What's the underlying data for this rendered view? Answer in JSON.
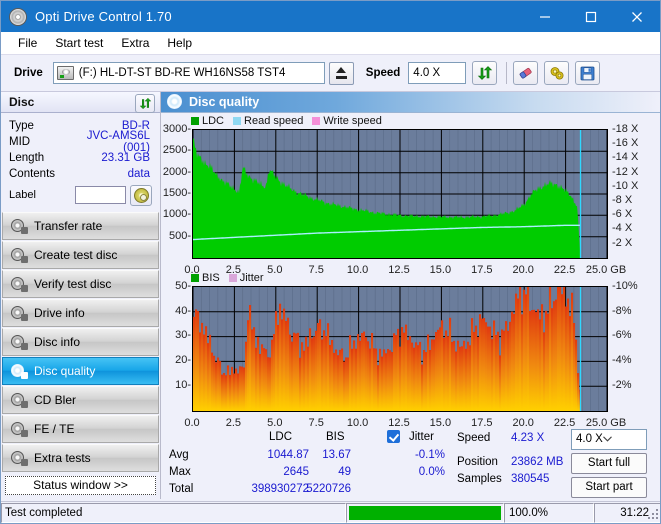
{
  "window": {
    "title": "Opti Drive Control 1.70",
    "icon": "disc-icon",
    "minimize": "minimize-icon",
    "maximize": "maximize-icon",
    "close": "close-icon"
  },
  "menu": [
    {
      "label": "File"
    },
    {
      "label": "Start test"
    },
    {
      "label": "Extra"
    },
    {
      "label": "Help"
    }
  ],
  "toolbar": {
    "drive_label": "Drive",
    "drive_value": "(F:)  HL-DT-ST BD-RE  WH16NS58 TST4",
    "eject_icon": "eject-icon",
    "speed_label": "Speed",
    "speed_value": "4.0 X",
    "refresh_icon": "refresh-icon",
    "erase_icon": "eraser-icon",
    "settings_icon": "gears-icon",
    "save_icon": "save-icon"
  },
  "disc_panel": {
    "title": "Disc",
    "refresh_icon": "refresh-icon",
    "rows": [
      {
        "key": "Type",
        "value": "BD-R"
      },
      {
        "key": "MID",
        "value": "JVC-AMS6L (001)"
      },
      {
        "key": "Length",
        "value": "23.31 GB"
      },
      {
        "key": "Contents",
        "value": "data"
      }
    ],
    "label_key": "Label",
    "label_value": "",
    "label_button_icon": "cd-icon"
  },
  "nav": {
    "items": [
      {
        "label": "Transfer rate",
        "active": false
      },
      {
        "label": "Create test disc",
        "active": false
      },
      {
        "label": "Verify test disc",
        "active": false
      },
      {
        "label": "Drive info",
        "active": false
      },
      {
        "label": "Disc info",
        "active": false
      },
      {
        "label": "Disc quality",
        "active": true
      },
      {
        "label": "CD Bler",
        "active": false
      },
      {
        "label": "FE / TE",
        "active": false
      },
      {
        "label": "Extra tests",
        "active": false
      }
    ],
    "status_window": "Status window >>"
  },
  "main": {
    "title": "Disc quality",
    "icon": "disc-quality-icon"
  },
  "stats": {
    "col_ldc": "LDC",
    "col_bis": "BIS",
    "jitter_label": "Jitter",
    "jitter_checked": true,
    "rows": [
      {
        "key": "Avg",
        "ldc": "1044.87",
        "bis": "13.67",
        "jitter": "-0.1%"
      },
      {
        "key": "Max",
        "ldc": "2645",
        "bis": "49",
        "jitter": "0.0%"
      },
      {
        "key": "Total",
        "ldc": "398930272",
        "bis": "5220726",
        "jitter": ""
      }
    ],
    "speed_key": "Speed",
    "speed_value": "4.23 X",
    "speed_select": "4.0 X",
    "position_key": "Position",
    "position_value": "23862 MB",
    "samples_key": "Samples",
    "samples_value": "380545",
    "start_full": "Start full",
    "start_part": "Start part"
  },
  "statusbar": {
    "text": "Test completed",
    "percent": "100.0%",
    "progress": 100,
    "time": "31:22"
  },
  "chart_data": [
    {
      "type": "area",
      "name": "ldc-chart",
      "title": "",
      "xlabel": "GB",
      "ylabel": "",
      "xlim": [
        0.0,
        25.0
      ],
      "xticks": [
        "0.0",
        "2.5",
        "5.0",
        "7.5",
        "10.0",
        "12.5",
        "15.0",
        "17.5",
        "20.0",
        "22.5",
        "25.0 GB"
      ],
      "xtickvals": [
        0.0,
        2.5,
        5.0,
        7.5,
        10.0,
        12.5,
        15.0,
        17.5,
        20.0,
        22.5,
        25.0
      ],
      "ylim": [
        0,
        3000
      ],
      "yticks": [
        "500",
        "1000",
        "1500",
        "2000",
        "2500",
        "3000"
      ],
      "ytickvals": [
        500,
        1000,
        1500,
        2000,
        2500,
        3000
      ],
      "y2lim": [
        0,
        18
      ],
      "y2ticks": [
        "2 X",
        "4 X",
        "6 X",
        "8 X",
        "10 X",
        "12 X",
        "14 X",
        "16 X",
        "18 X"
      ],
      "y2tickvals": [
        2,
        4,
        6,
        8,
        10,
        12,
        14,
        16,
        18
      ],
      "grid": true,
      "legend": [
        {
          "label": "LDC",
          "color": "#00a000"
        },
        {
          "label": "Read speed",
          "color": "#8fd8f2"
        },
        {
          "label": "Write speed",
          "color": "#f58fd8"
        }
      ],
      "series": [
        {
          "name": "LDC",
          "color": "#00cc00",
          "x": [
            0.0,
            0.2,
            0.4,
            0.6,
            0.8,
            1.0,
            1.2,
            1.4,
            1.6,
            1.8,
            2.0,
            2.2,
            2.4,
            2.6,
            2.8,
            3.0,
            3.2,
            3.4,
            3.6,
            3.8,
            4.0,
            4.2,
            4.4,
            4.6,
            4.8,
            5.0,
            5.2,
            5.4,
            5.6,
            5.8,
            6.0,
            6.4,
            6.8,
            7.2,
            7.6,
            8.0,
            8.4,
            8.8,
            9.2,
            9.6,
            10.0,
            10.5,
            11.0,
            11.5,
            12.0,
            12.5,
            13.0,
            13.5,
            14.0,
            14.5,
            15.0,
            15.5,
            16.0,
            16.5,
            17.0,
            17.5,
            18.0,
            18.5,
            19.0,
            19.5,
            20.0,
            20.4,
            20.8,
            21.2,
            21.6,
            22.0,
            22.4,
            22.8,
            23.2,
            23.4
          ],
          "values": [
            2800,
            2450,
            2350,
            2300,
            2200,
            2150,
            2050,
            1950,
            1900,
            1800,
            1750,
            1700,
            1650,
            1600,
            1530,
            2120,
            2000,
            1920,
            1850,
            1800,
            1740,
            1700,
            1680,
            2080,
            1980,
            1900,
            1820,
            1760,
            1700,
            1650,
            1600,
            1520,
            1460,
            1400,
            1350,
            1300,
            1260,
            1230,
            1200,
            1160,
            1130,
            1100,
            1060,
            1040,
            1020,
            1000,
            990,
            980,
            975,
            970,
            965,
            960,
            955,
            960,
            965,
            975,
            990,
            1020,
            1060,
            1120,
            1260,
            1480,
            1620,
            1700,
            1750,
            1720,
            1600,
            1480,
            1200,
            0
          ]
        },
        {
          "name": "Read speed",
          "color": "#a9f0ff",
          "x": [
            0.0,
            2.5,
            5.0,
            7.5,
            10.0,
            12.5,
            15.0,
            17.5,
            20.0,
            22.5,
            23.4
          ],
          "values": [
            2.6,
            2.9,
            3.2,
            3.5,
            3.7,
            3.9,
            4.1,
            4.3,
            4.4,
            4.6,
            4.6
          ]
        }
      ],
      "cursor_x": 23.4
    },
    {
      "type": "bar",
      "name": "bis-chart",
      "title": "",
      "xlabel": "GB",
      "ylabel": "",
      "xlim": [
        0.0,
        25.0
      ],
      "xticks": [
        "0.0",
        "2.5",
        "5.0",
        "7.5",
        "10.0",
        "12.5",
        "15.0",
        "17.5",
        "20.0",
        "22.5",
        "25.0 GB"
      ],
      "xtickvals": [
        0.0,
        2.5,
        5.0,
        7.5,
        10.0,
        12.5,
        15.0,
        17.5,
        20.0,
        22.5,
        25.0
      ],
      "ylim": [
        0,
        50
      ],
      "yticks": [
        "10",
        "20",
        "30",
        "40",
        "50"
      ],
      "ytickvals": [
        10,
        20,
        30,
        40,
        50
      ],
      "y2lim": [
        0,
        10
      ],
      "y2ticks": [
        "2%",
        "4%",
        "6%",
        "8%",
        "10%"
      ],
      "y2tickvals": [
        2,
        4,
        6,
        8,
        10
      ],
      "grid": true,
      "legend": [
        {
          "label": "BIS",
          "color": "#00a000"
        },
        {
          "label": "Jitter",
          "color": "#d9a7d9"
        }
      ],
      "series": [
        {
          "name": "BIS",
          "color": "#e86a10",
          "x": [
            0.0,
            0.25,
            0.5,
            0.75,
            1.0,
            1.25,
            1.5,
            1.75,
            2.0,
            2.25,
            2.5,
            2.75,
            3.0,
            3.25,
            3.5,
            3.75,
            4.0,
            4.25,
            4.5,
            4.75,
            5.0,
            5.25,
            5.5,
            5.75,
            6.0,
            6.25,
            6.5,
            6.75,
            7.0,
            7.25,
            7.5,
            7.75,
            8.0,
            8.25,
            8.5,
            8.75,
            9.0,
            9.5,
            10.0,
            10.5,
            11.0,
            11.5,
            12.0,
            12.5,
            13.0,
            13.5,
            14.0,
            14.5,
            15.0,
            15.5,
            16.0,
            16.5,
            17.0,
            17.5,
            18.0,
            18.5,
            19.0,
            19.5,
            20.0,
            20.5,
            21.0,
            21.5,
            22.0,
            22.5,
            23.0,
            23.4
          ],
          "values": [
            38,
            34,
            30,
            27,
            25,
            23,
            21,
            19,
            18,
            17,
            16,
            15,
            14,
            36,
            33,
            31,
            30,
            28,
            27,
            26,
            38,
            35,
            33,
            31,
            30,
            32,
            31,
            30,
            33,
            31,
            30,
            29,
            28,
            27,
            26,
            27,
            26,
            27,
            26,
            27,
            26,
            27,
            27,
            28,
            28,
            29,
            28,
            29,
            29,
            30,
            30,
            31,
            31,
            32,
            33,
            35,
            38,
            40,
            42,
            44,
            45,
            44,
            43,
            42,
            40,
            0
          ]
        }
      ],
      "cursor_x": 23.4
    }
  ]
}
